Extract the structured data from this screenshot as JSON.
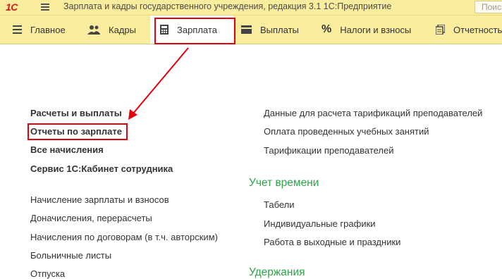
{
  "window": {
    "logo": "1С",
    "title": "Зарплата и кадры государственного учреждения, редакция 3.1 1С:Предприятие",
    "search_placeholder": "Поиск"
  },
  "toolbar": {
    "tabs": [
      {
        "label": "Главное",
        "icon": "list-icon"
      },
      {
        "label": "Кадры",
        "icon": "people-icon"
      },
      {
        "label": "Зарплата",
        "icon": "calculator-icon",
        "active": true
      },
      {
        "label": "Выплаты",
        "icon": "wallet-icon"
      },
      {
        "label": "Налоги и взносы",
        "icon": "percent-icon"
      },
      {
        "label": "Отчетность",
        "icon": "documents-icon"
      }
    ]
  },
  "left_column": {
    "bold_links": [
      "Расчеты и выплаты",
      "Отчеты по зарплате",
      "Все начисления",
      "Сервис 1С:Кабинет сотрудника"
    ],
    "links": [
      "Начисление зарплаты и взносов",
      "Доначисления, перерасчеты",
      "Начисления по договорам (в т.ч. авторским)",
      "Больничные листы",
      "Отпуска"
    ]
  },
  "right_column": {
    "links_top": [
      "Данные для расчета тарификаций преподавателей",
      "Оплата проведенных учебных занятий",
      "Тарификации преподавателей"
    ],
    "group_time": {
      "title": "Учет времени",
      "links": [
        "Табели",
        "Индивидуальные графики",
        "Работа в выходные и праздники"
      ]
    },
    "group_next_title": "Удержания"
  },
  "colors": {
    "toolbar_bg": "#fbed9e",
    "highlight": "#e3000f",
    "group_title": "#2fa34a",
    "logo": "#d81b1b"
  }
}
